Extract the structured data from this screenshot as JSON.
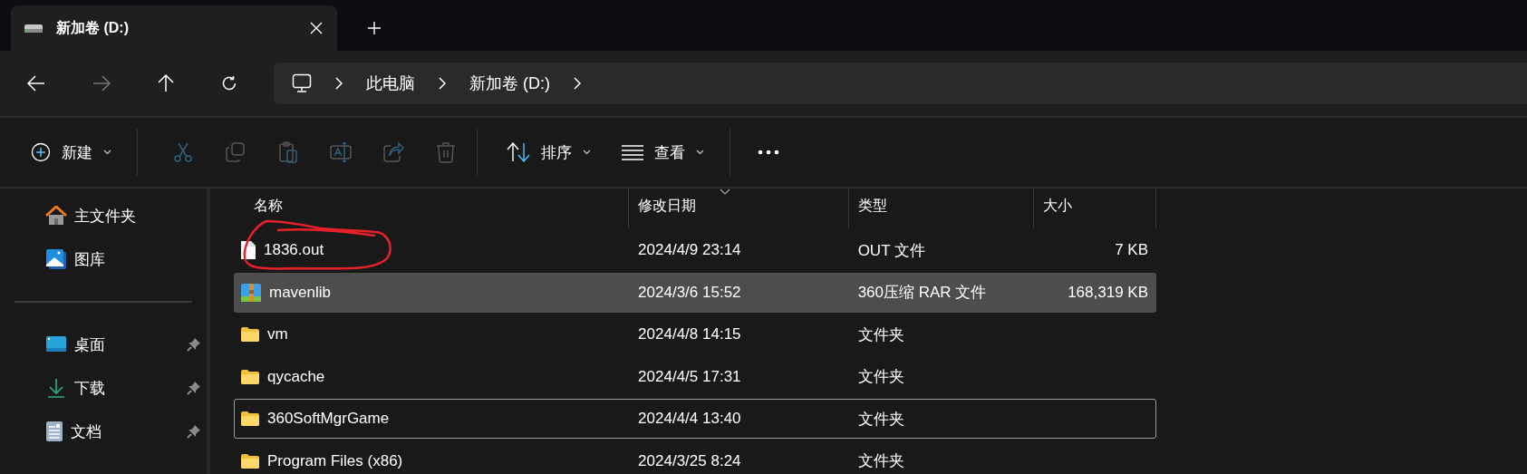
{
  "tab": {
    "title": "新加卷 (D:)",
    "selected": true
  },
  "breadcrumb": [
    "此电脑",
    "新加卷 (D:)"
  ],
  "toolbar": {
    "new_label": "新建",
    "actions": [
      {
        "disabled": true
      },
      {
        "disabled": true
      },
      {
        "disabled": true
      },
      {
        "disabled": true
      },
      {
        "disabled": true
      },
      {
        "disabled": true
      }
    ],
    "sort_label": "排序",
    "view_label": "查看"
  },
  "sidebar": {
    "groups": [
      {
        "items": [
          {
            "label": "主文件夹",
            "pinned": false
          },
          {
            "label": "图库",
            "pinned": false
          }
        ]
      },
      {
        "items": [
          {
            "label": "桌面",
            "pinned": true
          },
          {
            "label": "下载",
            "pinned": true
          },
          {
            "label": "文档",
            "pinned": true
          }
        ]
      }
    ]
  },
  "table": {
    "columns": [
      {
        "label": "名称",
        "sorted": false
      },
      {
        "label": "修改日期",
        "sorted": true
      },
      {
        "label": "类型",
        "sorted": false
      },
      {
        "label": "大小",
        "sorted": false
      }
    ],
    "rows": [
      {
        "kind": "file",
        "name": "1836.out",
        "modified": "2024/4/9 23:14",
        "type": "OUT 文件",
        "size": "7 KB",
        "selected": false,
        "focused": false
      },
      {
        "kind": "archive",
        "name": "mavenlib",
        "modified": "2024/3/6 15:52",
        "type": "360压缩 RAR 文件",
        "size": "168,319 KB",
        "selected": true,
        "focused": false
      },
      {
        "kind": "folder",
        "name": "vm",
        "modified": "2024/4/8 14:15",
        "type": "文件夹",
        "selected": false,
        "focused": false
      },
      {
        "kind": "folder",
        "name": "qycache",
        "modified": "2024/4/5 17:31",
        "type": "文件夹",
        "selected": false,
        "focused": false
      },
      {
        "kind": "folder",
        "name": "360SoftMgrGame",
        "modified": "2024/4/4 13:40",
        "type": "文件夹",
        "selected": false,
        "focused": true
      },
      {
        "kind": "folder",
        "name": "Program Files (x86)",
        "modified": "2024/3/25 8:24",
        "type": "文件夹",
        "selected": false,
        "focused": false
      }
    ]
  }
}
